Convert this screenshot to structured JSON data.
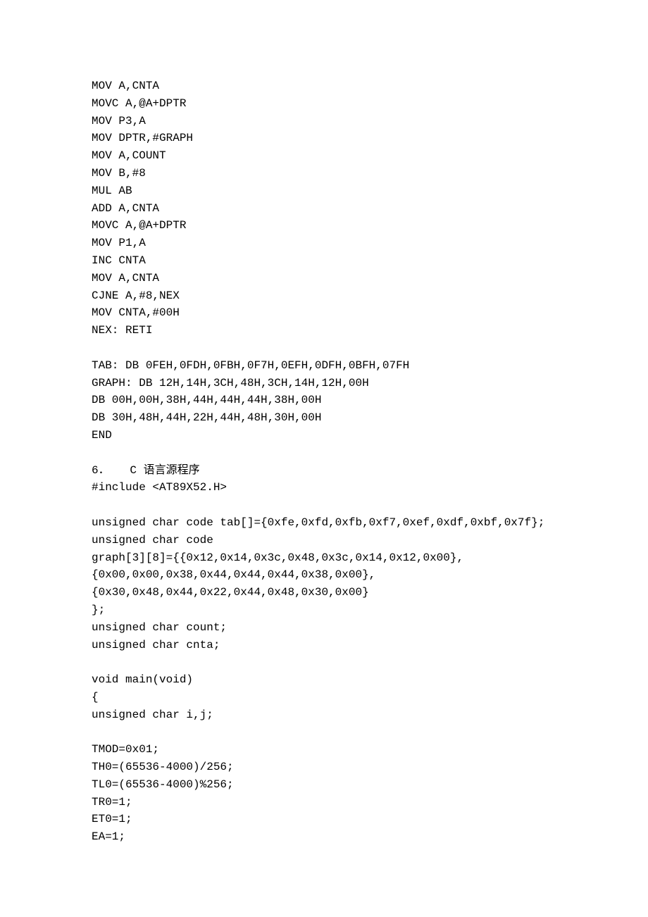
{
  "lines": [
    "MOV A,CNTA",
    "MOVC A,@A+DPTR",
    "MOV P3,A",
    "MOV DPTR,#GRAPH",
    "MOV A,COUNT",
    "MOV B,#8",
    "MUL AB",
    "ADD A,CNTA",
    "MOVC A,@A+DPTR",
    "MOV P1,A",
    "INC CNTA",
    "MOV A,CNTA",
    "CJNE A,#8,NEX",
    "MOV CNTA,#00H",
    "NEX: RETI",
    "",
    "TAB: DB 0FEH,0FDH,0FBH,0F7H,0EFH,0DFH,0BFH,07FH",
    "GRAPH: DB 12H,14H,3CH,48H,3CH,14H,12H,00H",
    "DB 00H,00H,38H,44H,44H,44H,38H,00H",
    "DB 30H,48H,44H,22H,44H,48H,30H,00H",
    "END",
    "",
    "6．   C 语言源程序",
    "#include <AT89X52.H>",
    "",
    "unsigned char code tab[]={0xfe,0xfd,0xfb,0xf7,0xef,0xdf,0xbf,0x7f};",
    "unsigned char code",
    "graph[3][8]={{0x12,0x14,0x3c,0x48,0x3c,0x14,0x12,0x00},",
    "{0x00,0x00,0x38,0x44,0x44,0x44,0x38,0x00},",
    "{0x30,0x48,0x44,0x22,0x44,0x48,0x30,0x00}",
    "};",
    "unsigned char count;",
    "unsigned char cnta;",
    "",
    "void main(void)",
    "{",
    "unsigned char i,j;",
    "",
    "TMOD=0x01;",
    "TH0=(65536-4000)/256;",
    "TL0=(65536-4000)%256;",
    "TR0=1;",
    "ET0=1;",
    "EA=1;"
  ]
}
